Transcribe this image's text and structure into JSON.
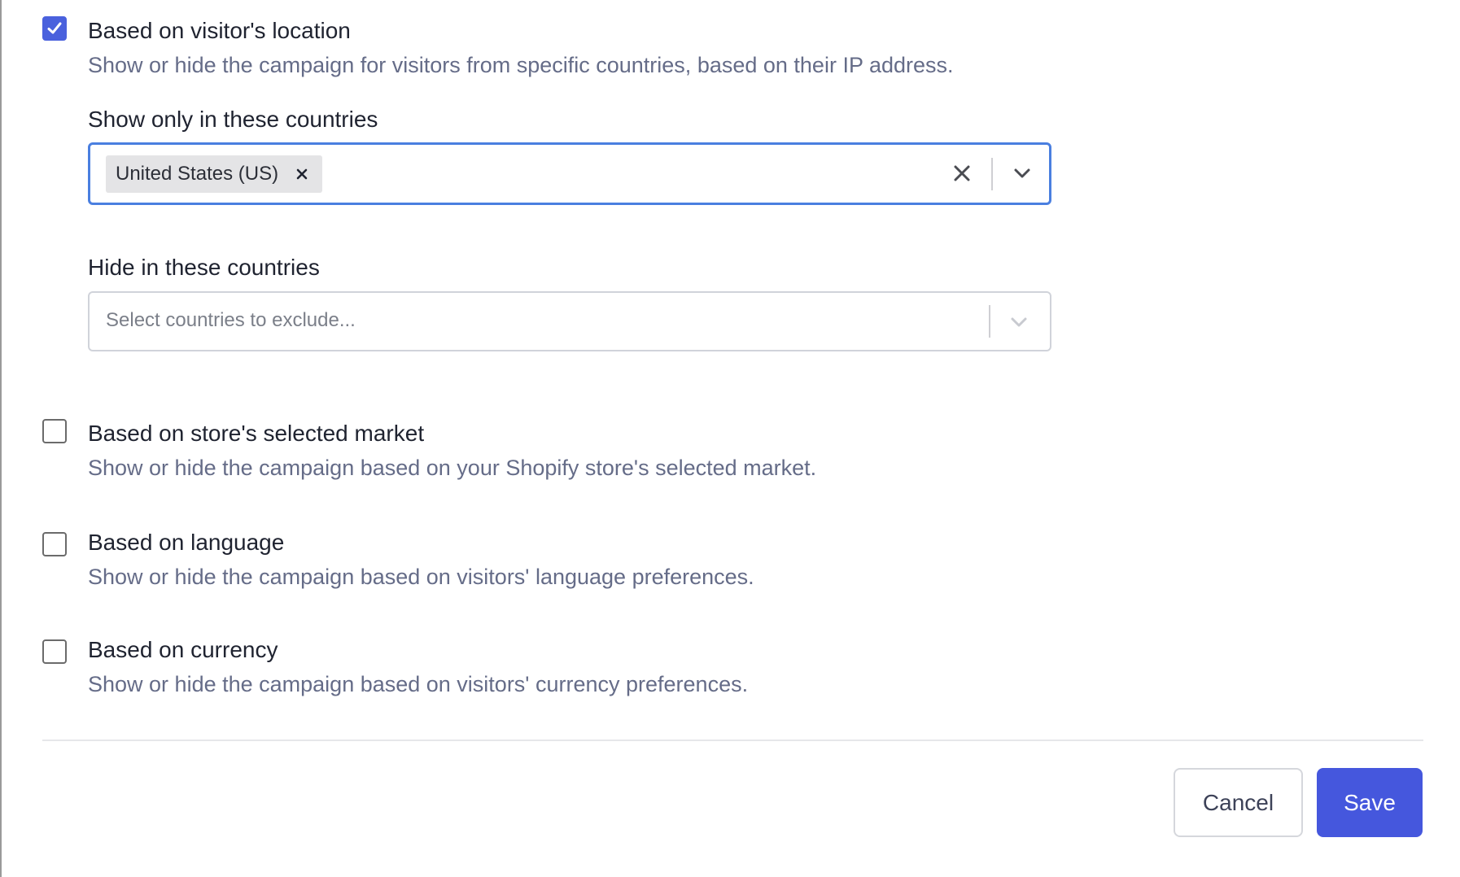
{
  "options": {
    "visitor_location": {
      "checked": true,
      "title": "Based on visitor's location",
      "description": "Show or hide the campaign for visitors from specific countries, based on their IP address."
    },
    "store_market": {
      "checked": false,
      "title": "Based on store's selected market",
      "description": "Show or hide the campaign based on your Shopify store's selected market."
    },
    "language": {
      "checked": false,
      "title": "Based on language",
      "description": "Show or hide the campaign based on visitors' language preferences."
    },
    "currency": {
      "checked": false,
      "title": "Based on currency",
      "description": "Show or hide the campaign based on visitors' currency preferences."
    }
  },
  "show_countries": {
    "label": "Show only in these countries",
    "selected": [
      "United States (US)"
    ]
  },
  "hide_countries": {
    "label": "Hide in these countries",
    "placeholder": "Select countries to exclude..."
  },
  "footer": {
    "cancel_label": "Cancel",
    "save_label": "Save"
  },
  "colors": {
    "accent": "#4557dd",
    "focus_border": "#4a7fe0",
    "description_text": "#656c88"
  },
  "icons": {
    "check": "checkmark-icon",
    "tag_remove": "close-icon",
    "clear": "clear-x-icon",
    "dropdown": "chevron-down-icon"
  }
}
